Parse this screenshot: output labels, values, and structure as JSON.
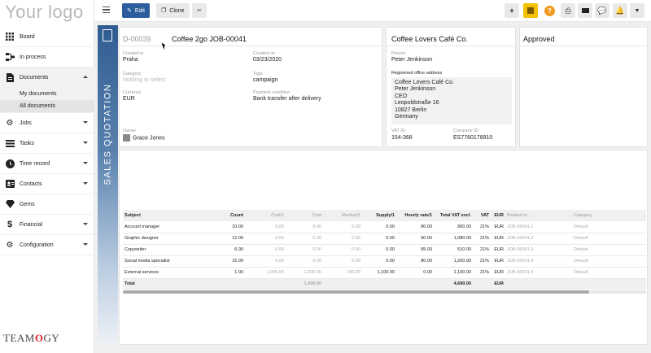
{
  "logo": "Your logo",
  "brand": "TEAMOGY",
  "nav": {
    "items": [
      {
        "label": "Board",
        "icon": "grid-icon"
      },
      {
        "label": "In process",
        "icon": "flow-icon"
      },
      {
        "label": "Documents",
        "icon": "document-icon"
      },
      {
        "label": "Jobs",
        "icon": "gear-icon"
      },
      {
        "label": "Tasks",
        "icon": "tasks-icon"
      },
      {
        "label": "Time record",
        "icon": "clock-icon"
      },
      {
        "label": "Contacts",
        "icon": "contacts-icon"
      },
      {
        "label": "Gems",
        "icon": "gem-icon"
      },
      {
        "label": "Financial",
        "icon": "dollar-icon"
      },
      {
        "label": "Configuration",
        "icon": "cog-icon"
      }
    ],
    "documents_sub": [
      "My documents",
      "All documents"
    ]
  },
  "toolbar": {
    "edit": "Edit",
    "clone": "Clone"
  },
  "strip_label": "SALES QUOTATION",
  "doc": {
    "number": "D-00039",
    "title": "Coffee 2go JOB-00041",
    "created_in_label": "Created in",
    "created_in": "Praha",
    "created_on_label": "Created on",
    "created_on": "03/23/2020",
    "category_label": "Category",
    "category_placeholder": "Nothing to select",
    "tags_label": "Tags",
    "tags": "campaign",
    "currency_label": "Currency",
    "currency": "EUR",
    "payment_label": "Payment condition",
    "payment": "Bank transfer after delivery",
    "owner_label": "Owner",
    "owner": "Grace Jones"
  },
  "customer": {
    "name": "Coffee Lovers Café Co.",
    "person_label": "Person",
    "person": "Peter Jenkinson",
    "address_label": "Registered office address",
    "address": [
      "Coffee Lovers Café Co.",
      "Peter Jenkinson",
      "CEO",
      "Leopoldstraße 16",
      "10827 Berlin",
      "Germany"
    ],
    "vat_label": "VAT ID",
    "vat": "154-368",
    "company_label": "Company ID",
    "company": "ES7760178910"
  },
  "status": "Approved",
  "table": {
    "headers": [
      "Subject",
      "Count",
      "Cost/1",
      "Cost",
      "Markup/1",
      "Supply/1",
      "Hourly rate/1",
      "Total VAT excl.",
      "VAT",
      "EUR",
      "Related to ...",
      "Category"
    ],
    "rows": [
      [
        "Account manager",
        "10.00",
        "0.00",
        "0.00",
        "0.00",
        "0.00",
        "80.00",
        "800.00",
        "21%",
        "EUR",
        "JOB-00041.1",
        "Default"
      ],
      [
        "Graphic designer",
        "12.00",
        "0.00",
        "0.00",
        "0.00",
        "0.00",
        "90.00",
        "1,080.00",
        "21%",
        "EUR",
        "JOB-00041.2",
        "Default"
      ],
      [
        "Copywriter",
        "6.00",
        "0.00",
        "0.00",
        "0.00",
        "0.00",
        "85.00",
        "510.00",
        "21%",
        "EUR",
        "JOB-00041.3",
        "Default"
      ],
      [
        "Social media specialist",
        "15.00",
        "0.00",
        "0.00",
        "0.00",
        "0.00",
        "80.00",
        "1,200.00",
        "21%",
        "EUR",
        "JOB-00041.4",
        "Default"
      ],
      [
        "External services",
        "1.00",
        "1,000.00",
        "1,000.00",
        "100.00",
        "1,100.00",
        "0.00",
        "1,100.00",
        "21%",
        "EUR",
        "JOB-00041.5",
        "Default"
      ]
    ],
    "total": {
      "label": "Total",
      "cost": "1,000.00",
      "sum": "4,690.00",
      "currency": "EUR"
    }
  }
}
